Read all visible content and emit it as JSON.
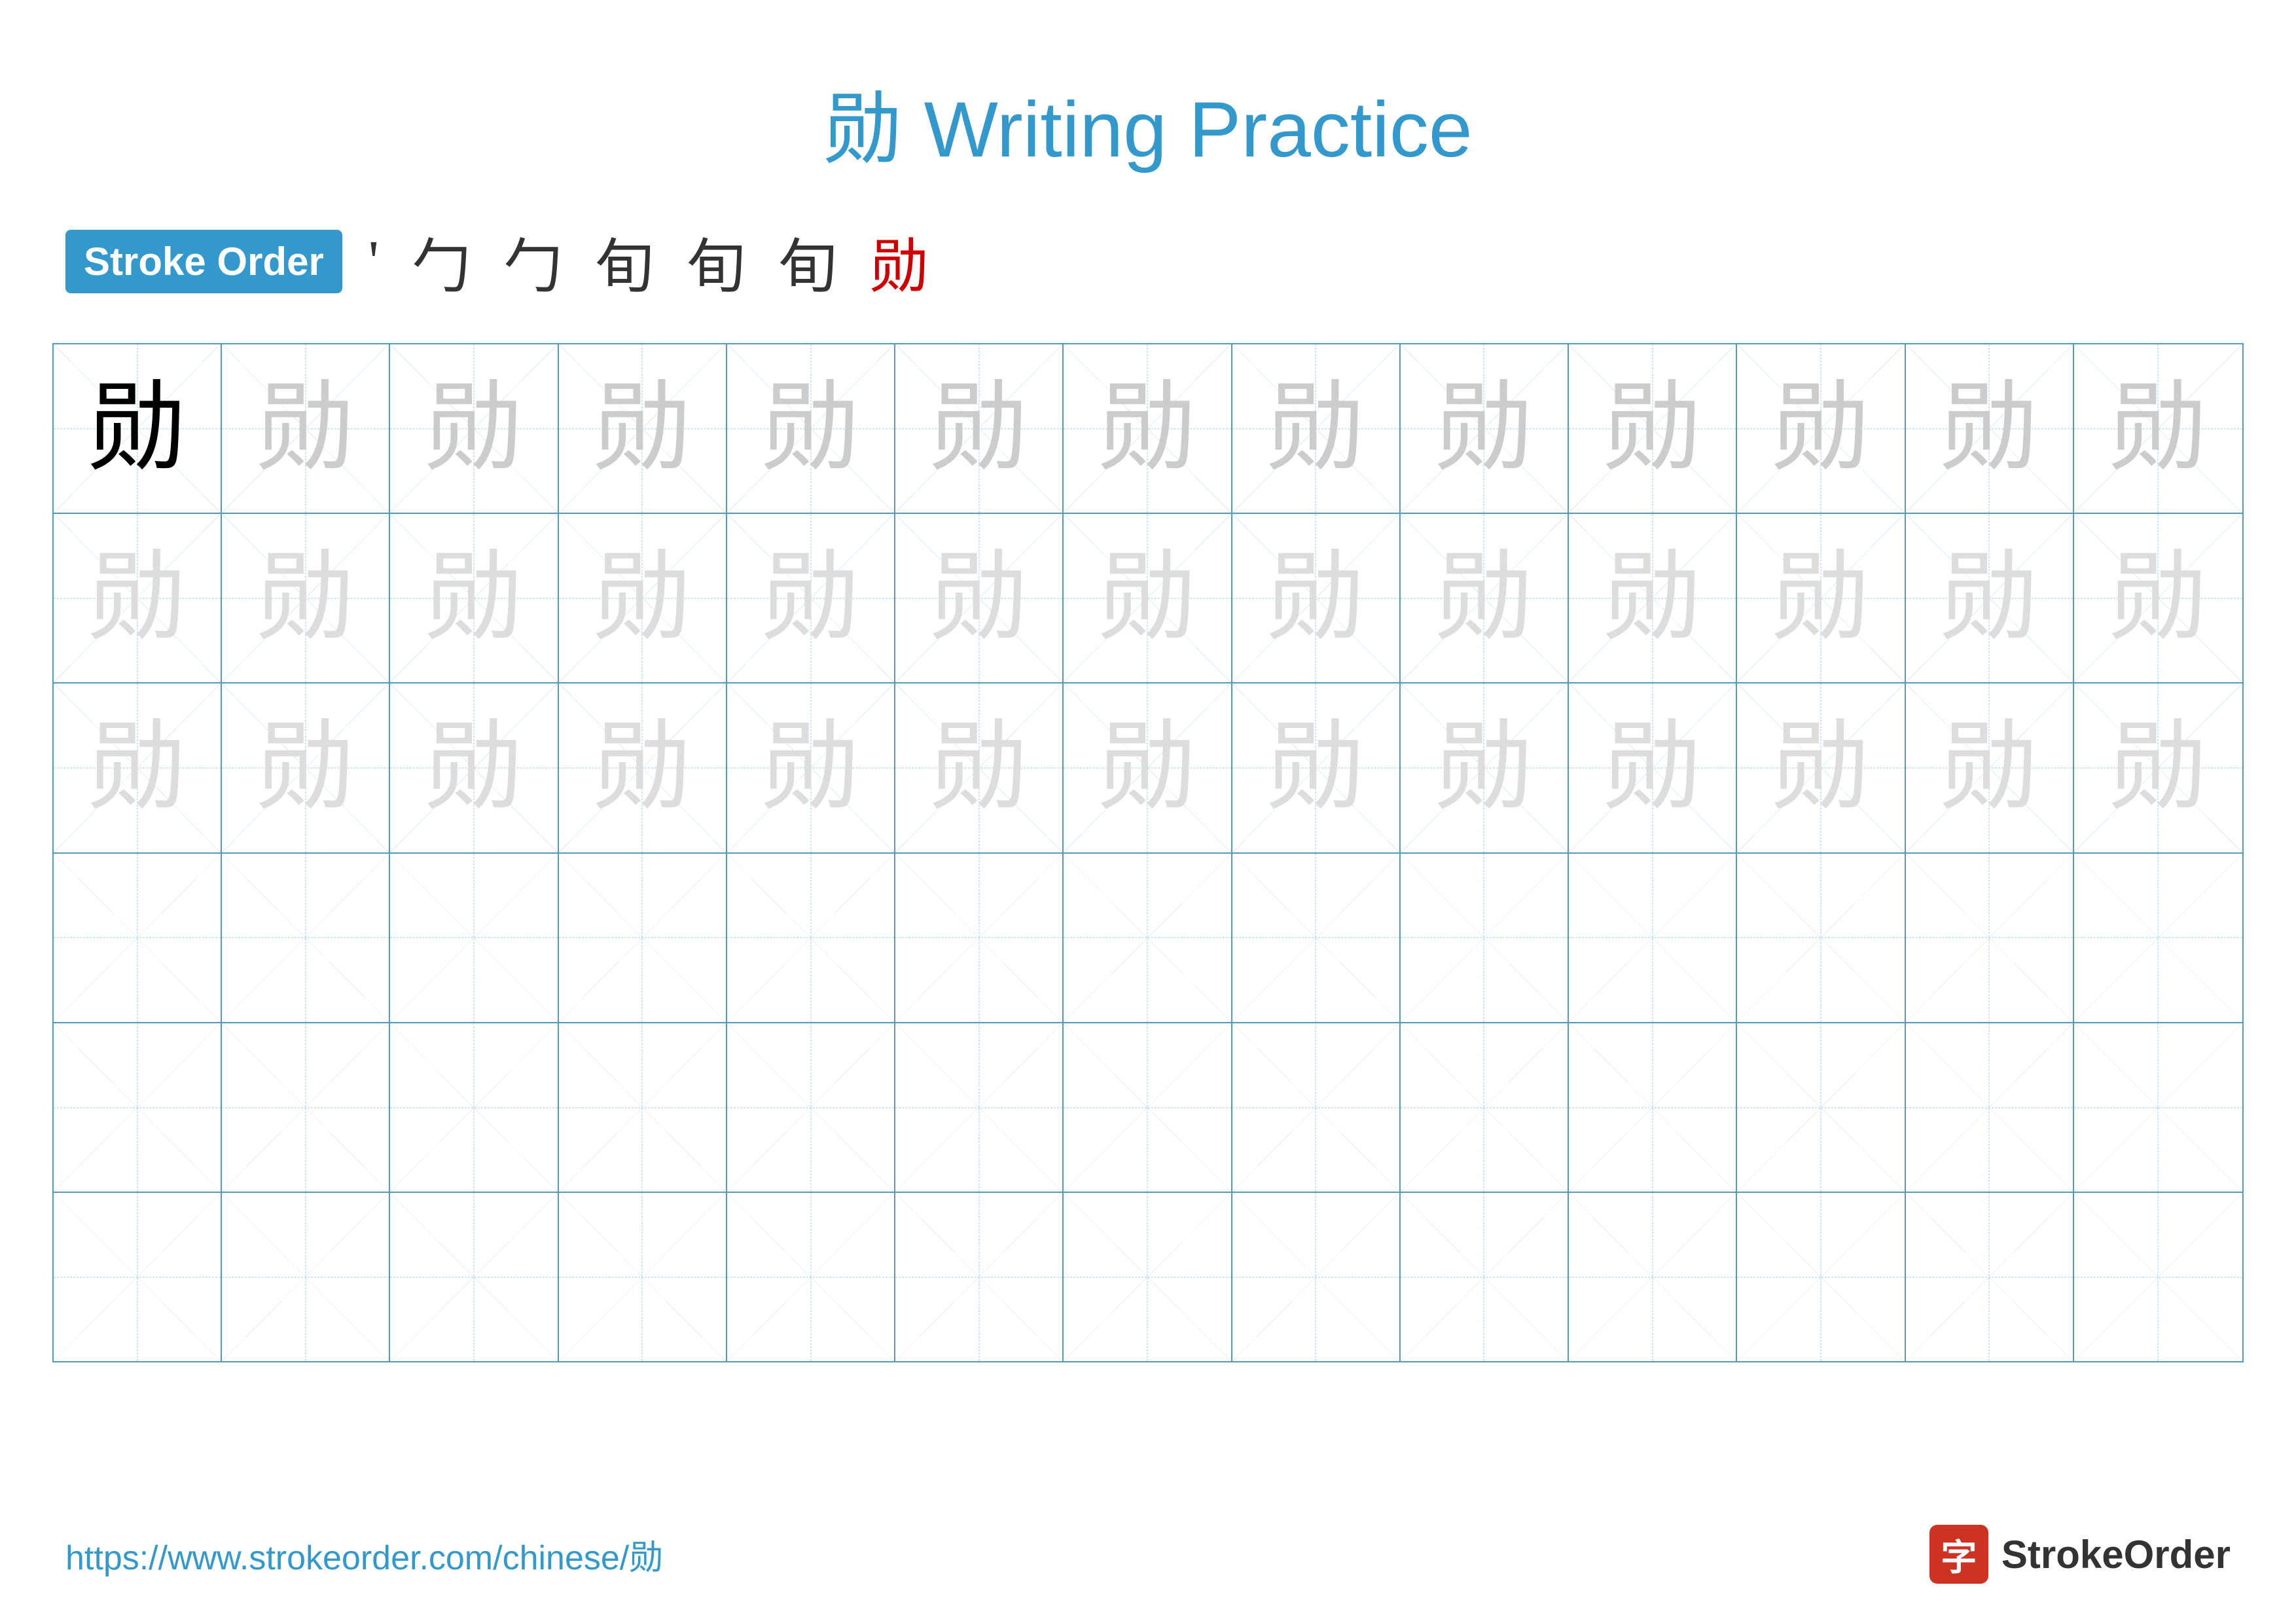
{
  "title": "勋 Writing Practice",
  "strokeOrder": {
    "badge": "Stroke Order",
    "strokes": [
      "'",
      "勹",
      "勹",
      "旬",
      "旬",
      "旬",
      "勋"
    ]
  },
  "character": "勋",
  "grid": {
    "rows": 6,
    "cols": 13,
    "solidRow": 0,
    "solidCol": 0,
    "lightRows": [
      1,
      2
    ],
    "emptyRows": [
      3,
      4,
      5
    ]
  },
  "footer": {
    "url": "https://www.strokeorder.com/chinese/勋",
    "logoText": "StrokeOrder",
    "logoChar": "字"
  }
}
